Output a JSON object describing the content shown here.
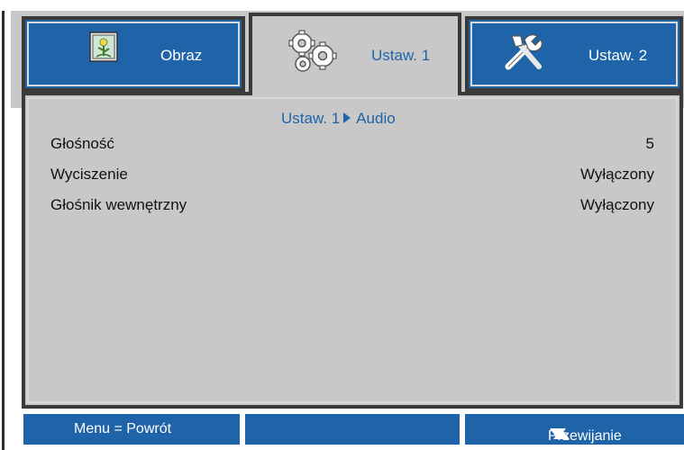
{
  "tabs": [
    {
      "label": "Obraz",
      "icon": "picture-icon",
      "active": false
    },
    {
      "label": "Ustaw. 1",
      "icon": "gears-icon",
      "active": true
    },
    {
      "label": "Ustaw. 2",
      "icon": "tools-icon",
      "active": false
    }
  ],
  "breadcrumb": {
    "parent": "Ustaw. 1",
    "child": "Audio"
  },
  "settings": [
    {
      "name": "Głośność",
      "value": "5"
    },
    {
      "name": "Wyciszenie",
      "value": "Wyłączony"
    },
    {
      "name": "Głośnik wewnętrzny",
      "value": "Wyłączony"
    }
  ],
  "footer": {
    "back_label": "Menu = Powrót",
    "middle_label": "",
    "scroll_label": "Przewijanie"
  },
  "colors": {
    "accent": "#1f63a8",
    "panel": "#c8c8c8",
    "border": "#3a3a3a"
  }
}
